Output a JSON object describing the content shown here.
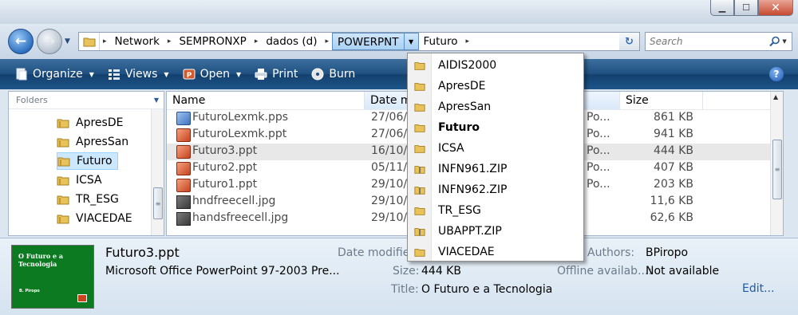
{
  "navigation": {
    "breadcrumbs": [
      "Network",
      "SEMPRONXP",
      "dados (d)",
      "POWERPNT",
      "Futuro"
    ],
    "active_crumb": "POWERPNT",
    "search_placeholder": "Search"
  },
  "toolbar": {
    "organize": "Organize",
    "views": "Views",
    "open": "Open",
    "print": "Print",
    "burn": "Burn",
    "help": "?"
  },
  "nav_pane": {
    "header": "Folders",
    "items": [
      "ApresDE",
      "ApresSan",
      "Futuro",
      "ICSA",
      "TR_ESG",
      "VIACEDAE"
    ],
    "selected": "Futuro"
  },
  "file_list": {
    "columns": {
      "name": "Name",
      "date": "Date m",
      "size": "Size"
    },
    "rows": [
      {
        "name": "FuturoLexmk.pps",
        "date": "27/06/",
        "type": "Po...",
        "size": "861 KB",
        "icon": "pps-icon"
      },
      {
        "name": "FuturoLexmk.ppt",
        "date": "27/06/",
        "type": "Po...",
        "size": "941 KB",
        "icon": "ppt-icon"
      },
      {
        "name": "Futuro3.ppt",
        "date": "16/10/",
        "type": "Po...",
        "size": "444 KB",
        "icon": "ppt-icon"
      },
      {
        "name": "Futuro2.ppt",
        "date": "05/11/",
        "type": "Po...",
        "size": "407 KB",
        "icon": "ppt-icon"
      },
      {
        "name": "Futuro1.ppt",
        "date": "29/10/",
        "type": "Po...",
        "size": "203 KB",
        "icon": "ppt-icon"
      },
      {
        "name": "hndfreecell.jpg",
        "date": "29/10/",
        "type": "",
        "size": "11,6 KB",
        "icon": "jpg-icon"
      },
      {
        "name": "handsfreecell.jpg",
        "date": "29/10/",
        "type": "",
        "size": "62,6 KB",
        "icon": "jpg-icon"
      }
    ],
    "selected_row": 2
  },
  "dropdown": {
    "items": [
      "AIDIS2000",
      "ApresDE",
      "ApresSan",
      "Futuro",
      "ICSA",
      "INFN961.ZIP",
      "INFN962.ZIP",
      "TR_ESG",
      "UBAPPT.ZIP",
      "VIACEDAE"
    ],
    "bold_item": "Futuro",
    "zip_items": [
      "INFN961.ZIP",
      "INFN962.ZIP",
      "UBAPPT.ZIP"
    ]
  },
  "details": {
    "filename": "Futuro3.ppt",
    "filetype": "Microsoft Office PowerPoint 97-2003 Pre...",
    "date_label": "Date modifie",
    "size_label": "Size:",
    "size_value": "444 KB",
    "title_label": "Title:",
    "title_value": "O Futuro e a Tecnologia",
    "authors_label": "Authors:",
    "authors_value": "BPiropo",
    "offline_label": "Offline availab...:",
    "offline_value": "Not available",
    "edit_link": "Edit...",
    "thumbnail_title": "O Futuro e a Tecnologia",
    "thumbnail_footer": "B. Piropo"
  },
  "colors": {
    "toolbar": "#1e4f80",
    "selection": "#cce8ff",
    "thumbnail_bg": "#0b7a20",
    "link": "#1f5aa8"
  }
}
